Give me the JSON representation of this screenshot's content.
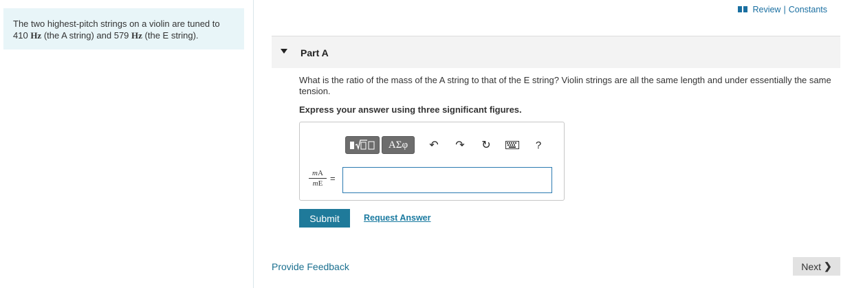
{
  "top_links": {
    "review": "Review",
    "separator": "|",
    "constants": "Constants"
  },
  "problem": {
    "text_1": "The two highest-pitch strings on a violin are tuned to 410 ",
    "unit_1": "Hz",
    "text_2": " (the A string) and 579 ",
    "unit_2": "Hz",
    "text_3": " (the E string)."
  },
  "part": {
    "title": "Part A",
    "question": "What is the ratio of the mass of the A string to that of the E string? Violin strings are all the same length and under essentially the same tension.",
    "instruction": "Express your answer using three significant figures."
  },
  "toolbar": {
    "greek_label": "ΑΣφ",
    "undo_glyph": "↶",
    "redo_glyph": "↷",
    "reset_glyph": "↻",
    "help_label": "?"
  },
  "answer": {
    "numerator_var": "m",
    "numerator_sub": "A",
    "denominator_var": "m",
    "denominator_sub": "E",
    "equals": "=",
    "value": ""
  },
  "actions": {
    "submit": "Submit",
    "request_answer": "Request Answer"
  },
  "footer": {
    "feedback": "Provide Feedback",
    "next": "Next",
    "next_chevron": "❯"
  }
}
